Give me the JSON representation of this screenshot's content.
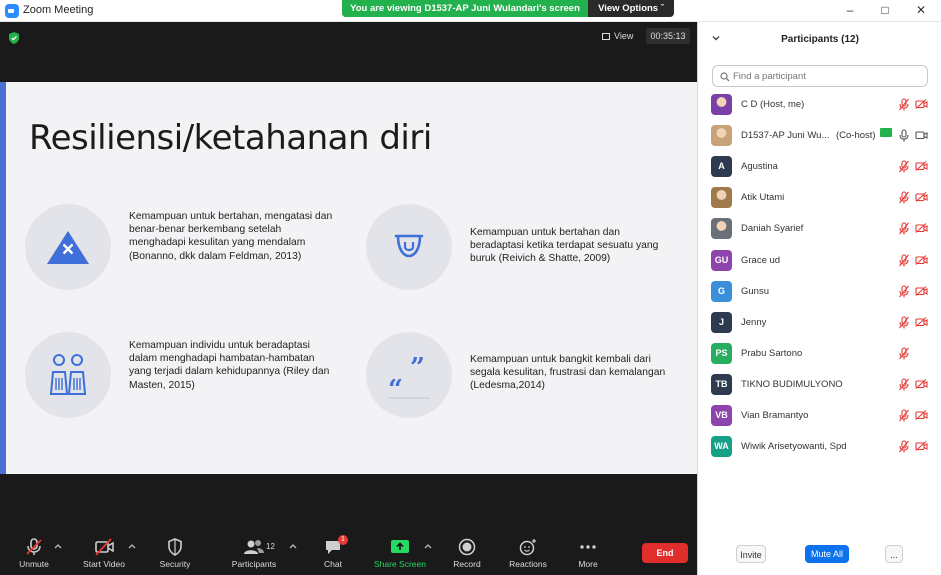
{
  "window": {
    "title": "Zoom Meeting"
  },
  "banner": {
    "viewing": "You are viewing D1537-AP Juni Wulandari's screen",
    "view_options": "View Options"
  },
  "stage": {
    "view_label": "View",
    "timer": "00:35:13"
  },
  "slide": {
    "title": "Resiliensi/ketahanan diri",
    "items": [
      {
        "icon": "warning-triangle-icon",
        "text": "Kemampuan untuk bertahan, mengatasi dan benar-benar berkembang setelah menghadapi kesulitan yang mendalam (Bonanno, dkk dalam Feldman, 2013)"
      },
      {
        "icon": "smile-tongue-icon",
        "text": "Kemampuan untuk bertahan dan beradaptasi ketika terdapat sesuatu yang buruk (Reivich & Shatte, 2009)"
      },
      {
        "icon": "people-figures-icon",
        "text": "Kemampuan individu untuk beradaptasi dalam menghadapi hambatan-hambatan yang terjadi dalam kehidupannya (Riley dan Masten, 2015)"
      },
      {
        "icon": "quote-icon",
        "text": "Kemampuan untuk bangkit kembali dari segala kesulitan, frustrasi dan kemalangan (Ledesma,2014)"
      }
    ]
  },
  "toolbar": {
    "unmute": "Unmute",
    "start_video": "Start Video",
    "security": "Security",
    "participants": "Participants",
    "participants_count": "12",
    "chat": "Chat",
    "chat_badge": "1",
    "share_screen": "Share Screen",
    "record": "Record",
    "reactions": "Reactions",
    "more": "More",
    "end": "End"
  },
  "panel": {
    "title": "Participants (12)",
    "search_placeholder": "Find a participant",
    "participants": [
      {
        "initials": "",
        "name": "C D (Host, me)",
        "avatar_color": "#7b3fa8",
        "photo": true,
        "mic_muted": true,
        "cam_off": true
      },
      {
        "initials": "",
        "name": "D1537-AP Juni Wu...",
        "suffix": "(Co-host)",
        "avatar_color": "#c9a27a",
        "photo": true,
        "mic_muted": false,
        "cam_off": false
      },
      {
        "initials": "A",
        "name": "Agustina",
        "avatar_color": "#2d3a4f",
        "mic_muted": true,
        "cam_off": true
      },
      {
        "initials": "",
        "name": "Atik Utami",
        "avatar_color": "#a07a4a",
        "photo": true,
        "mic_muted": true,
        "cam_off": true
      },
      {
        "initials": "",
        "name": "Daniah Syarief",
        "avatar_color": "#6b6f78",
        "photo": true,
        "mic_muted": true,
        "cam_off": true
      },
      {
        "initials": "GU",
        "name": "Grace ud",
        "avatar_color": "#8e44ad",
        "mic_muted": true,
        "cam_off": true
      },
      {
        "initials": "G",
        "name": "Gunsu",
        "avatar_color": "#3a8fd8",
        "mic_muted": true,
        "cam_off": true
      },
      {
        "initials": "J",
        "name": "Jenny",
        "avatar_color": "#2d3a4f",
        "mic_muted": true,
        "cam_off": true
      },
      {
        "initials": "PS",
        "name": "Prabu Sartono",
        "avatar_color": "#27ae60",
        "mic_muted": true,
        "cam_off": false,
        "no_cam": true
      },
      {
        "initials": "TB",
        "name": "TIKNO BUDIMULYONO",
        "avatar_color": "#2d3a4f",
        "mic_muted": true,
        "cam_off": true
      },
      {
        "initials": "VB",
        "name": "Vian Bramantyo",
        "avatar_color": "#8e44ad",
        "mic_muted": true,
        "cam_off": true
      },
      {
        "initials": "WA",
        "name": "Wiwik Arisetyowanti, Spd",
        "avatar_color": "#16a085",
        "mic_muted": true,
        "cam_off": true
      }
    ],
    "invite": "Invite",
    "mute_all": "Mute All",
    "more": "..."
  }
}
